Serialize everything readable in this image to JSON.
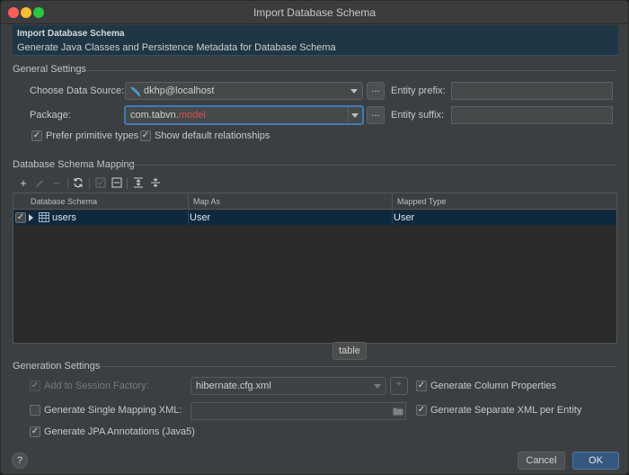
{
  "window": {
    "title": "Import Database Schema"
  },
  "banner": {
    "title": "Import Database Schema",
    "subtitle": "Generate Java Classes and Persistence Metadata for Database Schema"
  },
  "general": {
    "section_title": "General Settings",
    "data_source_label": "Choose Data Source:",
    "data_source_value": "dkhp@localhost",
    "package_label": "Package:",
    "package_value_prefix": "com.tabvn.",
    "package_value_suffix": "model",
    "entity_prefix_label": "Entity prefix:",
    "entity_suffix_label": "Entity suffix:",
    "entity_prefix_value": "",
    "entity_suffix_value": "",
    "prefer_primitive_label": "Prefer primitive types",
    "show_relationships_label": "Show default relationships",
    "browse_label": "..."
  },
  "mapping": {
    "section_title": "Database Schema Mapping",
    "columns": [
      "Database Schema",
      "Map As",
      "Mapped Type"
    ],
    "rows": [
      {
        "schema": "users",
        "map_as": "User",
        "mapped_type": "User",
        "checked": true
      }
    ],
    "tooltip": "table"
  },
  "generation": {
    "section_title": "Generation Settings",
    "add_session_factory_label": "Add to Session Factory:",
    "session_factory_value": "hibernate.cfg.xml",
    "single_mapping_label": "Generate Single Mapping XML:",
    "single_mapping_value": "",
    "jpa_annotations_label": "Generate JPA Annotations (Java5)",
    "column_properties_label": "Generate Column Properties",
    "separate_xml_label": "Generate Separate XML per Entity"
  },
  "footer": {
    "help_label": "?",
    "cancel_label": "Cancel",
    "ok_label": "OK"
  },
  "icons": {
    "checkmark": "✓",
    "add": "+",
    "remove": "−"
  },
  "colors": {
    "accent": "#3d7bb8",
    "selection": "#0d293e",
    "package_highlight": "#d9534f",
    "ok_button": "#365880"
  }
}
